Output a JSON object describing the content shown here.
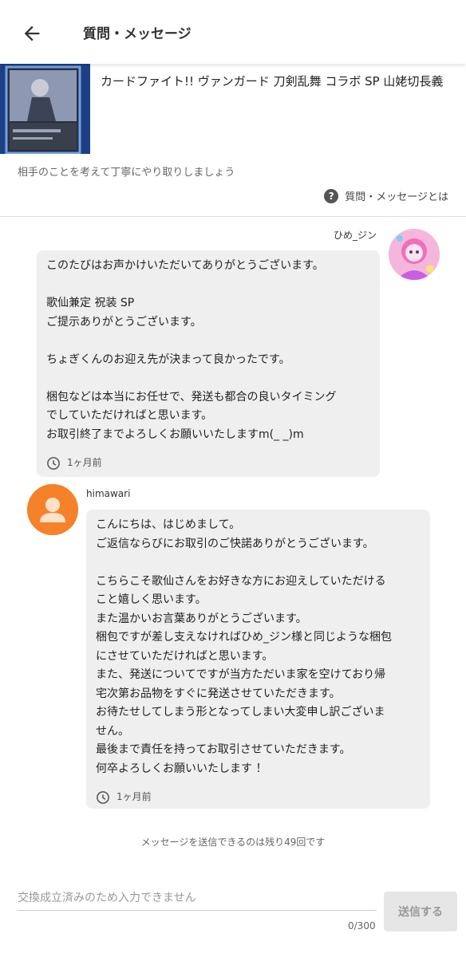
{
  "header": {
    "title": "質問・メッセージ"
  },
  "product": {
    "title": "カードファイト!! ヴァンガード 刀剣乱舞 コラボ SP 山姥切長義"
  },
  "note": "相手のことを考えて丁寧にやり取りしましょう",
  "about_link": "質問・メッセージとは",
  "messages": [
    {
      "sender": "ひめ_ジン",
      "text": "このたびはお声かけいただいてありがとうございます。\n\n歌仙兼定 祝装 SP\nご提示ありがとうございます。\n\nちょぎくんのお迎え先が決まって良かったです。\n\n梱包などは本当にお任せで、発送も都合の良いタイミング\nでしていただければと思います。\nお取引終了までよろしくお願いいたしますm(_ _)m",
      "time": "1ヶ月前"
    },
    {
      "sender": "himawari",
      "text": "こんにちは、はじめまして。\nご返信ならびにお取引のご快諾ありがとうございます。\n\nこちらこそ歌仙さんをお好きな方にお迎えしていただける\nこと嬉しく思います。\nまた温かいお言葉ありがとうございます。\n梱包ですが差し支えなければひめ_ジン様と同じような梱包\nにさせていただければと思います。\nまた、発送についてですが当方ただいま家を空けており帰\n宅次第お品物をすぐに発送させていただきます。\nお待たせしてしまう形となってしまい大変申し訳ございま\nせん。\n最後まで責任を持ってお取引させていただきます。\n何卒よろしくお願いいたします ！",
      "time": "1ヶ月前"
    }
  ],
  "remaining_text": "メッセージを送信できるのは残り49回です",
  "input": {
    "placeholder": "交換成立済みのため入力できません",
    "counter": "0/300"
  },
  "send_button": "送信する",
  "colors": {
    "bubble": "#efefef",
    "avatar_orange": "#f5822a",
    "avatar_pink": "#f49ad2"
  }
}
